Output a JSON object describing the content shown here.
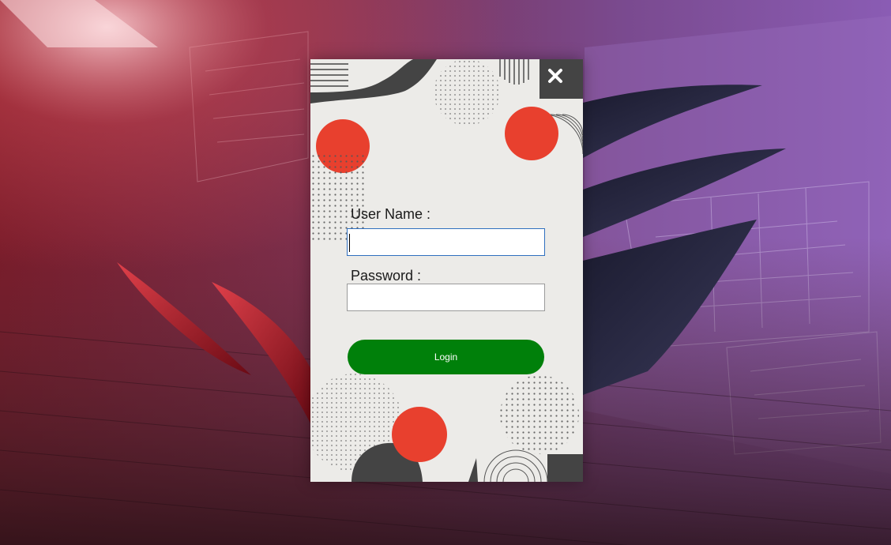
{
  "login_form": {
    "username_label": "User Name :",
    "username_value": "",
    "password_label": "Password :",
    "password_value": "",
    "login_button_label": "Login"
  },
  "icons": {
    "close": "close-icon"
  },
  "colors": {
    "panel_background": "#ecebe8",
    "accent_red": "#e8402e",
    "dark_shape": "#444444",
    "login_button": "#00800a",
    "focused_input_border": "#2f6fbf"
  }
}
